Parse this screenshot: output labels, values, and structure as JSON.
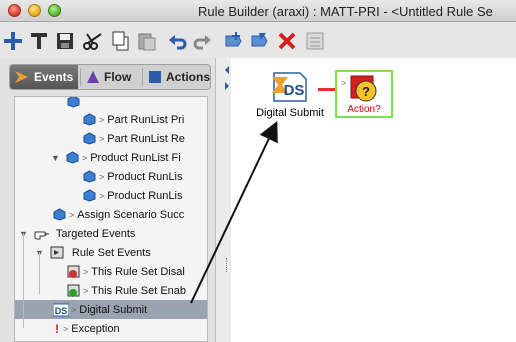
{
  "window": {
    "title": "Rule Builder (araxi) : MATT-PRI - <Untitled Rule Se"
  },
  "toolbar": {
    "buttons": [
      "new-icon",
      "text-icon",
      "save-icon",
      "cut-icon",
      "copy-icon",
      "paste-icon",
      "undo-icon",
      "redo-icon",
      "add-rule-icon",
      "edit-rule-icon",
      "delete-icon",
      "properties-icon"
    ]
  },
  "tabs": [
    {
      "label": "Events",
      "active": true
    },
    {
      "label": "Flow",
      "active": false
    },
    {
      "label": "Actions",
      "active": false
    }
  ],
  "tree": {
    "rows": [
      {
        "label": ""
      },
      {
        "label": "Part RunList Pri"
      },
      {
        "label": "Part RunList Re"
      },
      {
        "label": "Product RunList Fi"
      },
      {
        "label": "Product RunLis"
      },
      {
        "label": "Product RunLis"
      },
      {
        "label": "Assign Scenario Succ"
      },
      {
        "label": "Targeted Events"
      },
      {
        "label": "Rule Set Events"
      },
      {
        "label": "This Rule Set Disal"
      },
      {
        "label": "This Rule Set Enab"
      },
      {
        "label": "Digital Submit"
      },
      {
        "label": "Exception"
      }
    ]
  },
  "canvas": {
    "nodes": {
      "digital_submit": {
        "label": "Digital Submit",
        "icon_text": "DS"
      },
      "action": {
        "label": "Action?",
        "icon_text": "?"
      }
    }
  },
  "colors": {
    "selection": "#9aa3b0",
    "accent_green": "#7fe04a",
    "connector_red": "#e03030",
    "action_red": "#cc0000"
  }
}
